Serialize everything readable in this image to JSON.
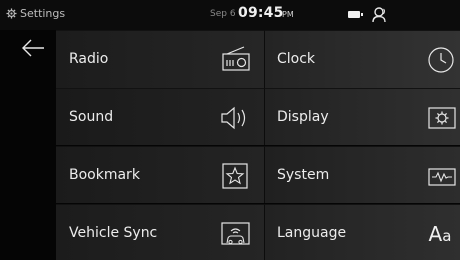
{
  "status": {
    "app_title": "Settings",
    "date": "Sep 6",
    "time": "09:45",
    "ampm": "PM"
  },
  "icons": {
    "back": "back-arrow-icon",
    "settings": "gear-icon",
    "battery": "battery-icon",
    "profile": "profile-icon"
  },
  "menu": [
    {
      "label": "Radio",
      "icon": "radio-icon"
    },
    {
      "label": "Clock",
      "icon": "clock-icon"
    },
    {
      "label": "Sound",
      "icon": "speaker-icon"
    },
    {
      "label": "Display",
      "icon": "display-gear-icon"
    },
    {
      "label": "Bookmark",
      "icon": "star-icon"
    },
    {
      "label": "System",
      "icon": "waveform-icon"
    },
    {
      "label": "Vehicle Sync",
      "icon": "vehicle-sync-icon"
    },
    {
      "label": "Language",
      "icon": "language-icon",
      "glyph_big": "A",
      "glyph_small": "a"
    }
  ]
}
